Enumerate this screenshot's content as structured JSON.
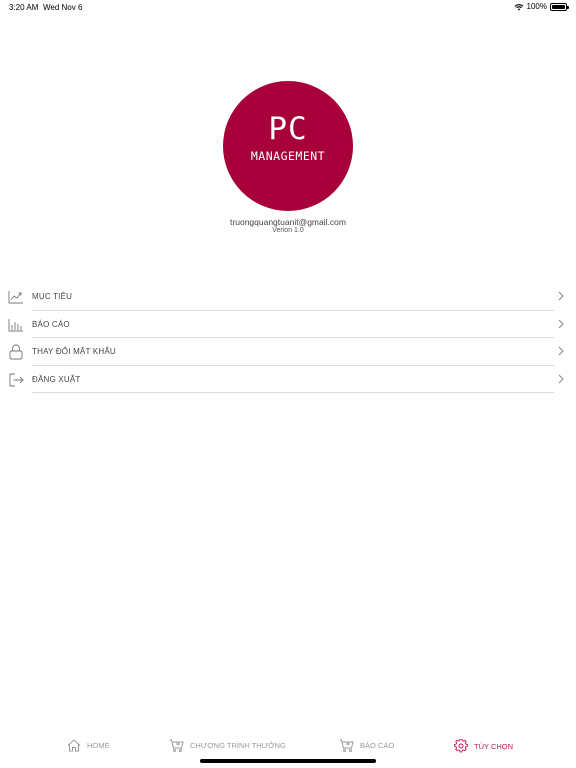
{
  "status_bar": {
    "time": "3:20 AM",
    "date": "Wed Nov 6",
    "battery": "100%"
  },
  "logo": {
    "main": "PC",
    "sub": "MANAGEMENT",
    "color": "#a8003a"
  },
  "profile": {
    "email": "truongquangtuanit@gmail.com",
    "version": "Verion 1.0"
  },
  "menu": {
    "items": [
      {
        "label": "MỤC TIÊU",
        "icon": "trend-chart-icon"
      },
      {
        "label": "BÁO CÁO",
        "icon": "bar-chart-icon"
      },
      {
        "label": "THAY ĐỔI MẬT KHẨU",
        "icon": "lock-icon"
      },
      {
        "label": "ĐĂNG XUẤT",
        "icon": "logout-icon"
      }
    ]
  },
  "tabs": {
    "active_color": "#c2185b",
    "items": [
      {
        "label": "HOME",
        "icon": "home-icon",
        "active": false
      },
      {
        "label": "CHƯƠNG TRÌNH THƯỞNG",
        "icon": "cart-icon",
        "active": false
      },
      {
        "label": "BÁO CÁO",
        "icon": "cart-icon",
        "active": false
      },
      {
        "label": "TÙY CHỌN",
        "icon": "gear-icon",
        "active": true
      }
    ]
  }
}
